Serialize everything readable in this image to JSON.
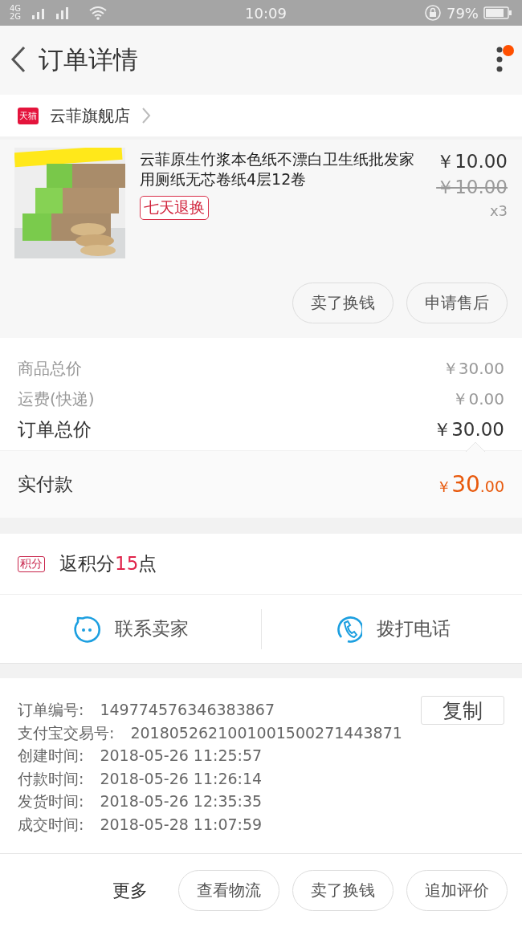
{
  "status_bar": {
    "network": "4G 2G",
    "time": "10:09",
    "battery": "79%"
  },
  "header": {
    "title": "订单详情",
    "notification_dot": true
  },
  "store": {
    "badge": "天猫",
    "name": "云菲旗舰店"
  },
  "product": {
    "kind": "picture",
    "title": "云菲原生竹浆本色纸不漂白卫生纸批发家用厕纸无芯卷纸4层12卷",
    "tag": "七天退换",
    "price": "￥10.00",
    "original_price": "￥10.00",
    "quantity": "x3",
    "actions": [
      "卖了换钱",
      "申请售后"
    ]
  },
  "summary": [
    {
      "label": "商品总价",
      "value": "￥30.00",
      "kind": "minor"
    },
    {
      "label": "运费(快递)",
      "value": "￥0.00",
      "kind": "minor"
    },
    {
      "label": "订单总价",
      "value": "￥30.00",
      "kind": "major"
    }
  ],
  "paid": {
    "label": "实付款",
    "currency": "￥",
    "integer": "30",
    "decimal": ".00"
  },
  "points": {
    "badge": "积分",
    "prefix": "返积分",
    "amount": "15",
    "suffix": "点"
  },
  "contact": [
    {
      "label": "联系卖家",
      "kind": "chat"
    },
    {
      "label": "拨打电话",
      "kind": "phone"
    }
  ],
  "info": {
    "copy_button": "复制",
    "rows": [
      {
        "label": "订单编号:",
        "value": "149774576346383867"
      },
      {
        "label": "支付宝交易号:",
        "value": "2018052621001001500271443871"
      },
      {
        "label": "创建时间:",
        "value": "2018-05-26 11:25:57"
      },
      {
        "label": "付款时间:",
        "value": "2018-05-26 11:26:14"
      },
      {
        "label": "发货时间:",
        "value": "2018-05-26 12:35:35"
      },
      {
        "label": "成交时间:",
        "value": "2018-05-28 11:07:59"
      }
    ]
  },
  "bottom_bar": {
    "more": "更多",
    "buttons": [
      "查看物流",
      "卖了换钱",
      "追加评价"
    ]
  }
}
